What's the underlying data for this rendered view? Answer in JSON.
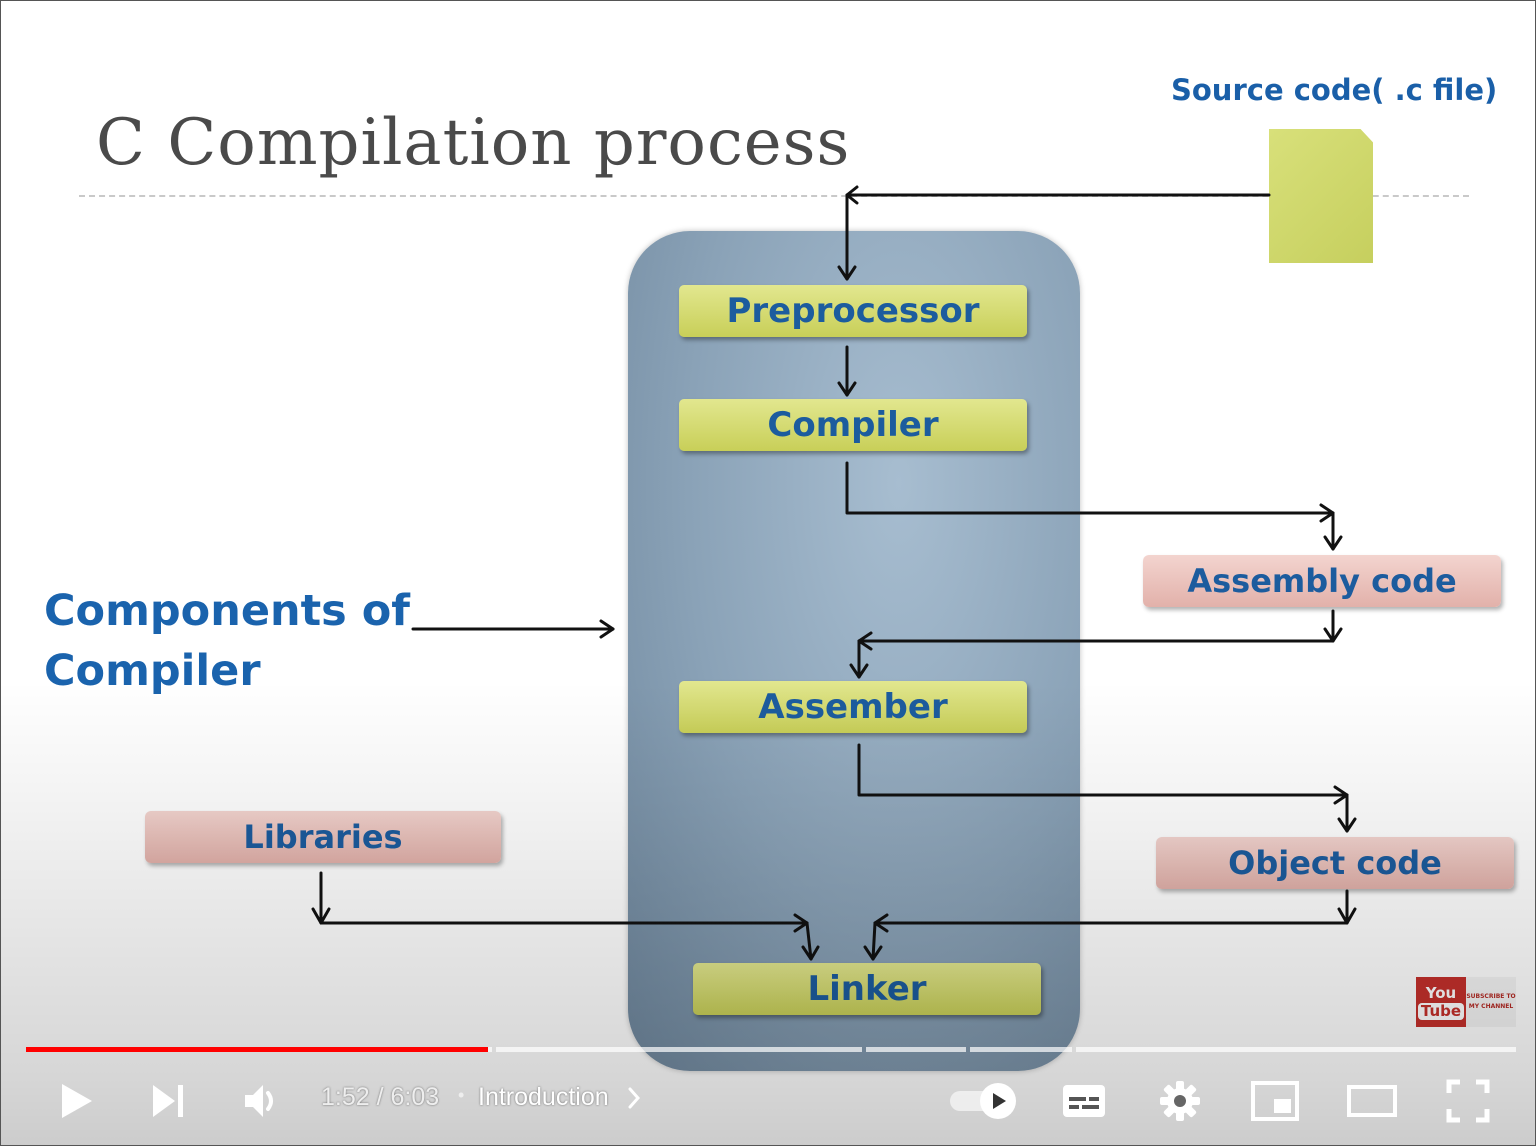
{
  "slide": {
    "title": "C Compilation process",
    "source_label": "Source code( .c file)",
    "components_label_line1": "Components of",
    "components_label_line2": "Compiler",
    "stages": {
      "preprocessor": "Preprocessor",
      "compiler": "Compiler",
      "assembler": "Assember",
      "linker": "Linker"
    },
    "outputs": {
      "assembly": "Assembly code",
      "object": "Object code",
      "libraries": "Libraries"
    },
    "colors": {
      "title": "#4a4a4a",
      "label_blue": "#1a63ad",
      "stage_box": "#d6dc70",
      "output_box": "#ebc3bd",
      "panel": "#8aa2b7"
    }
  },
  "youtube_badge": {
    "line1": "You",
    "line2": "Tube",
    "subscribe_text": "SUBSCRIBE TO MY CHANNEL"
  },
  "player": {
    "progress_fraction": 0.31,
    "current_time": "1:52",
    "duration": "6:03",
    "time_display": "1:52 / 6:03",
    "chapter": "Introduction",
    "separator": "•",
    "icons": {
      "play": "play-icon",
      "next": "next-icon",
      "volume": "volume-icon",
      "autoplay": "autoplay-toggle-icon",
      "subtitles": "subtitles-icon",
      "settings": "gear-icon",
      "miniplayer": "miniplayer-icon",
      "theater": "theater-icon",
      "fullscreen": "fullscreen-icon"
    },
    "colors": {
      "played": "#ff0000",
      "icon": "#ffffff"
    }
  }
}
